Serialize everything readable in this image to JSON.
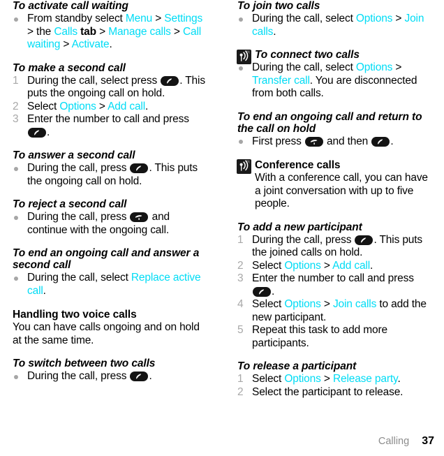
{
  "footer": {
    "chapter": "Calling",
    "page_number": "37"
  },
  "colors": {
    "link": "#00dcf5",
    "marker": "#a6a6a6",
    "icon_bg": "#141414"
  },
  "icons": {
    "call_key": "call-key-icon",
    "end_call_key": "end-call-key-icon",
    "network_service": "network-service-icon"
  },
  "left_column": {
    "s1": {
      "heading": "To activate call waiting",
      "bullet_parts": {
        "t1": "From standby select ",
        "l1": "Menu",
        "t2": " > ",
        "l2": "Settings",
        "t3": " > the ",
        "l3": "Calls",
        "t4": " tab",
        "t5": " > ",
        "l4": "Manage calls",
        "t6": " > ",
        "l5": "Call waiting",
        "t7": " > ",
        "l6": "Activate",
        "t8": "."
      }
    },
    "s2": {
      "heading": "To make a second call",
      "step1_a": "During the call, select press ",
      "step1_b": ". This puts the ongoing call on hold.",
      "step2_a": "Select ",
      "step2_l1": "Options",
      "step2_b": " > ",
      "step2_l2": "Add call",
      "step2_c": ".",
      "step3_a": "Enter the number to call and press ",
      "step3_b": "."
    },
    "s3": {
      "heading": "To answer a second call",
      "bullet_a": "During the call, press ",
      "bullet_b": ". This puts the ongoing call on hold."
    },
    "s4": {
      "heading": "To reject a second call",
      "bullet_a": "During the call, press ",
      "bullet_b": " and continue with the ongoing call."
    },
    "s5": {
      "heading": "To end an ongoing call and answer a second call",
      "bullet_a": "During the call, select ",
      "bullet_l": "Replace active call",
      "bullet_b": "."
    },
    "s6": {
      "heading": "Handling two voice calls",
      "body": "You can have calls ongoing and on hold at the same time."
    },
    "s7": {
      "heading": "To switch between two calls",
      "bullet_a": "During the call, press ",
      "bullet_b": "."
    }
  },
  "right_column": {
    "s1": {
      "heading": "To join two calls",
      "bullet_a": "During the call, select ",
      "bullet_l1": "Options",
      "bullet_b": " > ",
      "bullet_l2": "Join calls",
      "bullet_c": "."
    },
    "s2": {
      "heading": "To connect two calls",
      "has_network_icon": true,
      "bullet_a": "During the call, select ",
      "bullet_l1": "Options",
      "bullet_b": " > ",
      "bullet_l2": "Transfer call",
      "bullet_c": ". You are disconnected from both calls."
    },
    "s3": {
      "heading": "To end an ongoing call and return to the call on hold",
      "bullet_a": "First press ",
      "bullet_b": " and then ",
      "bullet_c": "."
    },
    "s4": {
      "heading": "Conference calls",
      "has_network_icon": true,
      "body": "With a conference call, you can have a joint conversation with up to five people."
    },
    "s5": {
      "heading": "To add a new participant",
      "step1_a": "During the call, press ",
      "step1_b": ". This puts the joined calls on hold.",
      "step2_a": "Select ",
      "step2_l1": "Options",
      "step2_b": " > ",
      "step2_l2": "Add call",
      "step2_c": ".",
      "step3_a": "Enter the number to call and press ",
      "step3_b": ".",
      "step4_a": "Select ",
      "step4_l1": "Options",
      "step4_b": " > ",
      "step4_l2": "Join calls",
      "step4_c": " to add the new participant.",
      "step5": "Repeat this task to add more participants."
    },
    "s6": {
      "heading": "To release a participant",
      "step1_a": "Select ",
      "step1_l1": "Options",
      "step1_b": " > ",
      "step1_l2": "Release party",
      "step1_c": ".",
      "step2": "Select the participant to release."
    }
  },
  "markers": {
    "n1": "1",
    "n2": "2",
    "n3": "3",
    "n4": "4",
    "n5": "5"
  }
}
